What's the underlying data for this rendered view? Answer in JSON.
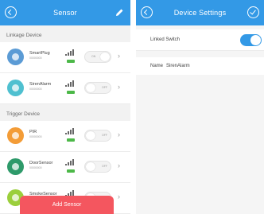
{
  "left_screen": {
    "title": "Sensor",
    "sections": [
      {
        "label": "Linkage Device",
        "devices": [
          {
            "name": "SmartPlug",
            "sub": "00000000",
            "color": "#5b9bd5",
            "state": "ON",
            "toggle_on_label": "ON",
            "toggle_off_label": ""
          },
          {
            "name": "SirenAlarm",
            "sub": "00000000",
            "color": "#4fc0d0",
            "state": "OFF",
            "toggle_on_label": "",
            "toggle_off_label": "OFF"
          }
        ]
      },
      {
        "label": "Trigger Device",
        "devices": [
          {
            "name": "PIR",
            "sub": "00000000",
            "color": "#f39c37",
            "state": "OFF",
            "toggle_on_label": "",
            "toggle_off_label": "OFF"
          },
          {
            "name": "DoorSensor",
            "sub": "00000000",
            "color": "#2e9a6a",
            "state": "OFF",
            "toggle_on_label": "",
            "toggle_off_label": "OFF"
          },
          {
            "name": "SmokeSensor",
            "sub": "",
            "color": "#9bcf3c",
            "state": "OFF",
            "toggle_on_label": "",
            "toggle_off_label": "OFF"
          }
        ]
      }
    ],
    "add_button": "Add Sensor"
  },
  "right_screen": {
    "title": "Device Settings",
    "linked_switch": {
      "label": "Linked Switch",
      "on": true
    },
    "name_row": {
      "label": "Name",
      "value": "SirenAlarm"
    }
  },
  "colors": {
    "accent": "#3399e6",
    "add_button": "#f4565f",
    "battery": "#4cb848"
  }
}
